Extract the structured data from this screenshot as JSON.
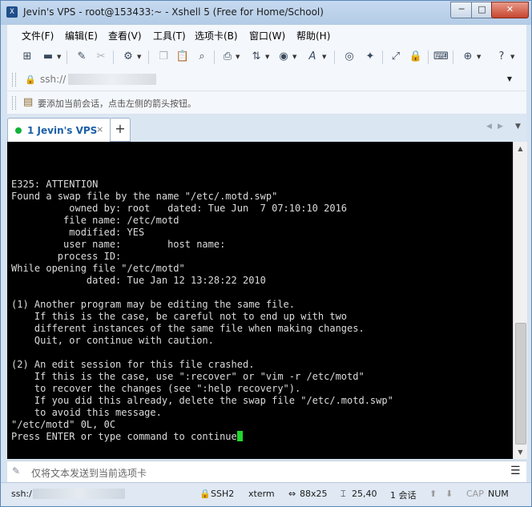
{
  "window": {
    "title": "Jevin's VPS - root@153433:~ - Xshell 5 (Free for Home/School)",
    "app_icon_label": "X",
    "buttons": {
      "minimize": "─",
      "maximize": "□",
      "close": "✕"
    }
  },
  "menu": {
    "items": [
      "文件(F)",
      "编辑(E)",
      "查看(V)",
      "工具(T)",
      "选项卡(B)",
      "窗口(W)",
      "帮助(H)"
    ]
  },
  "toolbar": {
    "icons": [
      "new-session-icon",
      "open-folder-icon",
      "connect-icon",
      "disconnect-icon",
      "properties-icon",
      "copy-icon",
      "paste-icon",
      "find-icon",
      "print-icon",
      "transfer-icon",
      "globe-icon",
      "font-icon",
      "xftp-icon",
      "xmanager-icon",
      "fullscreen-icon",
      "lock-icon",
      "keyboard-icon",
      "add-icon",
      "help-icon"
    ]
  },
  "address": {
    "value": "ssh://",
    "drop_glyph": "▼"
  },
  "hint": {
    "text": "要添加当前会话，点击左侧的箭头按钮。"
  },
  "tabs": {
    "active": {
      "label": "1 Jevin's VPS",
      "close_glyph": "×",
      "status_color": "#12b23a"
    },
    "add_glyph": "+",
    "nav_prev": "◀",
    "nav_next": "▶"
  },
  "terminal": {
    "lines": [
      "E325: ATTENTION",
      "Found a swap file by the name \"/etc/.motd.swp\"",
      "          owned by: root   dated: Tue Jun  7 07:10:10 2016",
      "         file name: /etc/motd",
      "          modified: YES",
      "         user name:        host name:",
      "        process ID:",
      "While opening file \"/etc/motd\"",
      "             dated: Tue Jan 12 13:28:22 2010",
      "",
      "(1) Another program may be editing the same file.",
      "    If this is the case, be careful not to end up with two",
      "    different instances of the same file when making changes.",
      "    Quit, or continue with caution.",
      "",
      "(2) An edit session for this file crashed.",
      "    If this is the case, use \":recover\" or \"vim -r /etc/motd\"",
      "    to recover the changes (see \":help recovery\").",
      "    If you did this already, delete the swap file \"/etc/.motd.swp\"",
      "    to avoid this message.",
      "\"/etc/motd\" 0L, 0C",
      "Press ENTER or type command to continue"
    ],
    "cursor_color": "#23d62d"
  },
  "compose": {
    "placeholder": "仅将文本发送到当前选项卡",
    "menu_glyph": "☰"
  },
  "status": {
    "connection": "ssh:/",
    "protocol": "SSH2",
    "terminal_type": "xterm",
    "size": "88x25",
    "cursor_pos": "25,40",
    "sessions": "1 会话",
    "caps": "CAP",
    "num": "NUM"
  }
}
